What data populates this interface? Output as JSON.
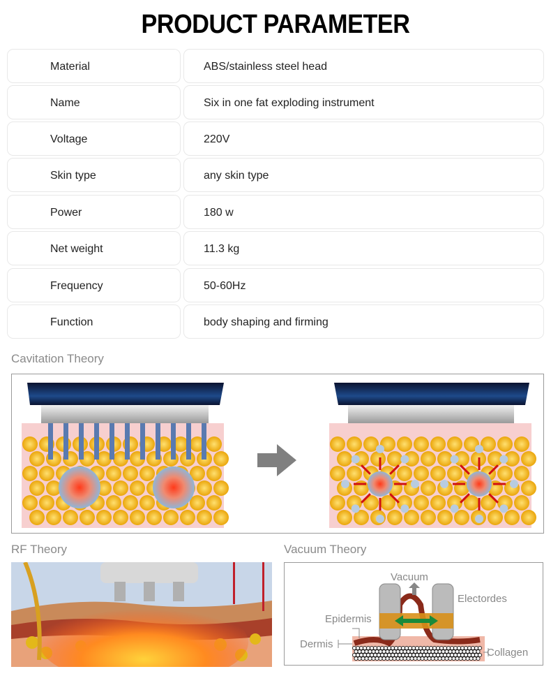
{
  "title": "PRODUCT PARAMETER",
  "params": [
    {
      "label": "Material",
      "value": "ABS/stainless steel head"
    },
    {
      "label": "Name",
      "value": "Six in one fat exploding instrument"
    },
    {
      "label": "Voltage",
      "value": "220V"
    },
    {
      "label": "Skin type",
      "value": "any skin type"
    },
    {
      "label": "Power",
      "value": "180 w"
    },
    {
      "label": "Net weight",
      "value": "11.3 kg"
    },
    {
      "label": "Frequency",
      "value": " 50-60Hz"
    },
    {
      "label": "Function",
      "value": " body shaping and firming"
    }
  ],
  "cavitation": {
    "title": "Cavitation Theory"
  },
  "rf": {
    "title": "RF Theory"
  },
  "vacuum": {
    "title": "Vacuum Theory",
    "labels": {
      "vacuum": "Vacuum",
      "electrodes": "Electordes",
      "epidermis": "Epidermis",
      "dermis": "Dermis",
      "collagen": "Collagen"
    }
  },
  "colors": {
    "fat": "#f2b619",
    "skin": "#f7cfcf",
    "probe": "#0d1a3a",
    "arrow": "#808080"
  }
}
